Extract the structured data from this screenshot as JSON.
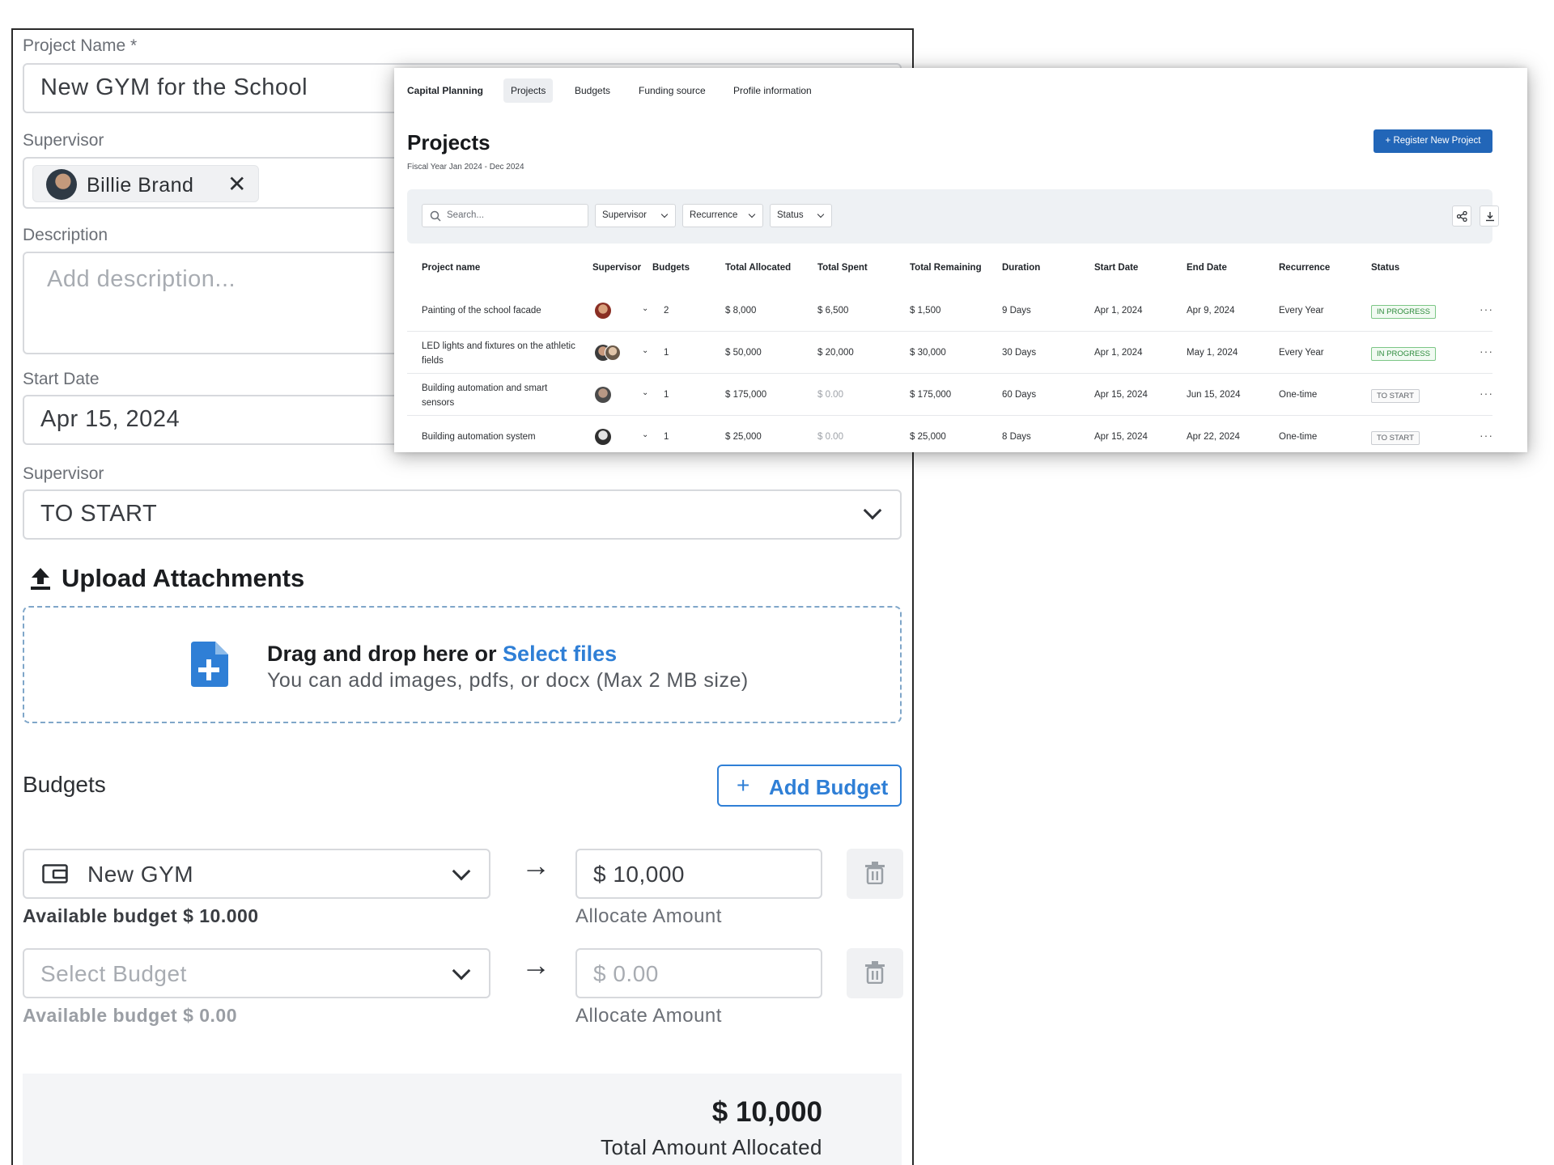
{
  "form": {
    "project_name_label": "Project Name *",
    "project_name_value": "New GYM for the School",
    "supervisor_label": "Supervisor",
    "supervisor_chip": "Billie Brand",
    "description_label": "Description",
    "description_placeholder": "Add description...",
    "start_date_label": "Start Date",
    "start_date_value": "Apr 15, 2024",
    "status_label": "Supervisor",
    "status_value": "TO START",
    "upload_title": "Upload Attachments",
    "drop_text": "Drag and drop here or ",
    "drop_link": "Select files",
    "drop_hint": "You can add images, pdfs, or docx (Max 2 MB size)",
    "budgets_title": "Budgets",
    "add_budget_label": "Add Budget",
    "budget_rows": [
      {
        "budget": "New GYM",
        "amount": "$ 10,000",
        "available": "Available budget $ 10.000",
        "allocate_label": "Allocate Amount"
      },
      {
        "budget": "Select Budget",
        "amount": "$ 0.00",
        "available": "Available budget $ 0.00",
        "allocate_label": "Allocate Amount"
      }
    ],
    "total_value": "$ 10,000",
    "total_label": "Total Amount Allocated"
  },
  "panel": {
    "nav": [
      "Capital Planning",
      "Projects",
      "Budgets",
      "Funding source",
      "Profile information"
    ],
    "title": "Projects",
    "subtitle": "Fiscal Year Jan 2024 - Dec 2024",
    "register_button": "Register New Project",
    "search_placeholder": "Search...",
    "filters": [
      "Supervisor",
      "Recurrence",
      "Status"
    ],
    "columns": [
      "Project name",
      "Supervisor",
      "Budgets",
      "Total Allocated",
      "Total Spent",
      "Total Remaining",
      "Duration",
      "Start Date",
      "End Date",
      "Recurrence",
      "Status"
    ],
    "rows": [
      {
        "name": "Painting of the school facade",
        "budgets": "2",
        "allocated": "$ 8,000",
        "spent": "$ 6,500",
        "remaining": "$ 1,500",
        "duration": "9 Days",
        "start": "Apr 1, 2024",
        "end": "Apr 9, 2024",
        "recurrence": "Every Year",
        "status": "IN PROGRESS"
      },
      {
        "name": "LED lights and fixtures on the athletic fields",
        "budgets": "1",
        "allocated": "$ 50,000",
        "spent": "$ 20,000",
        "remaining": "$ 30,000",
        "duration": "30 Days",
        "start": "Apr 1, 2024",
        "end": "May 1, 2024",
        "recurrence": "Every Year",
        "status": "IN PROGRESS"
      },
      {
        "name": "Building automation and smart sensors",
        "budgets": "1",
        "allocated": "$ 175,000",
        "spent": "$ 0.00",
        "remaining": "$ 175,000",
        "duration": "60 Days",
        "start": "Apr 15, 2024",
        "end": "Jun 15, 2024",
        "recurrence": "One-time",
        "status": "TO START"
      },
      {
        "name": "Building automation system",
        "budgets": "1",
        "allocated": "$ 25,000",
        "spent": "$ 0.00",
        "remaining": "$ 25,000",
        "duration": "8 Days",
        "start": "Apr 15, 2024",
        "end": "Apr 22, 2024",
        "recurrence": "One-time",
        "status": "TO START"
      }
    ]
  },
  "colors": {
    "accent": "#2f7fd6",
    "primary_button": "#2266b8",
    "success": "#2e8b3c"
  }
}
